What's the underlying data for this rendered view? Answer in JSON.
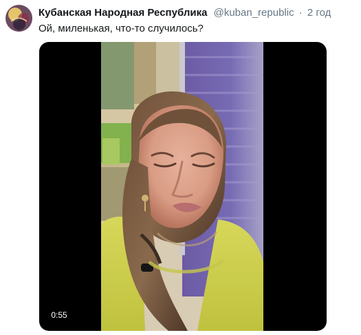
{
  "tweet": {
    "display_name": "Кубанская Народная Республика",
    "username": "@kuban_republic",
    "separator": "·",
    "time": "2 год",
    "text": "Ой, миленькая, что-то случилось?"
  },
  "media": {
    "duration": "0:55",
    "avatar_icon": "profile-avatar-icon",
    "video_icon": "video-thumbnail"
  },
  "colors": {
    "name": "#14171a",
    "secondary": "#657786",
    "media_background": "#000000"
  }
}
